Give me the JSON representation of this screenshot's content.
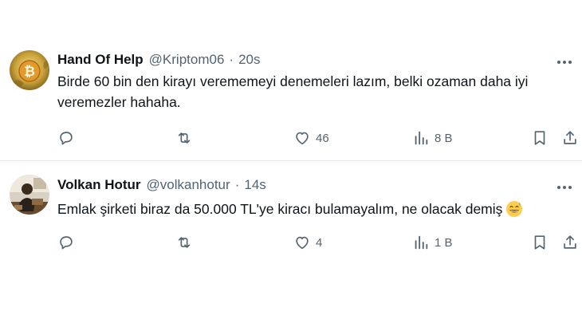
{
  "tweets": [
    {
      "display_name": "Hand Of Help",
      "handle": "@Kriptom06",
      "separator": "·",
      "time": "20s",
      "text": "Birde 60 bin den kirayı verememeyi denemeleri lazım, belki ozaman daha iyi veremezler hahaha.",
      "likes": "46",
      "views": "8 B",
      "avatar_icon": "bitcoin-avatar"
    },
    {
      "display_name": "Volkan Hotur",
      "handle": "@volkanhotur",
      "separator": "·",
      "time": "14s",
      "text": "Emlak şirketi biraz da 50.000 TL'ye kiracı bulamayalım, ne olacak demiş",
      "emoji": "grinning-sweat-emoji",
      "likes": "4",
      "views": "1 B",
      "avatar_icon": "person-photo-avatar"
    }
  ],
  "colors": {
    "text_primary": "#0f1419",
    "text_secondary": "#536471",
    "divider": "#e4e8eb"
  }
}
